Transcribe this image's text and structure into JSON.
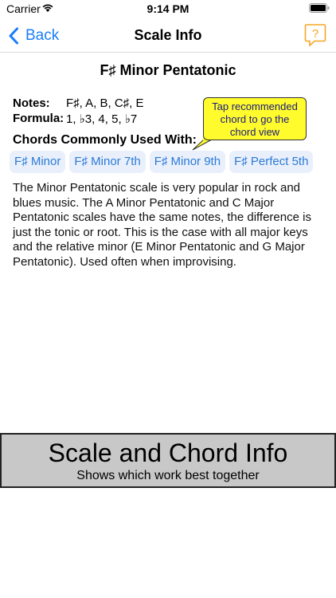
{
  "status_bar": {
    "carrier": "Carrier",
    "time": "9:14 PM"
  },
  "nav": {
    "back_label": "Back",
    "title": "Scale Info",
    "help_icon": "help-question-bubble-icon",
    "accent_color": "#1a7ef7",
    "help_color": "#f5a623"
  },
  "scale": {
    "title": "F♯ Minor Pentatonic",
    "notes_label": "Notes:",
    "notes_value": "F♯, A, B, C♯, E",
    "formula_label": "Formula:",
    "formula_value": "1, ♭3, 4, 5, ♭7"
  },
  "tooltip": {
    "text_line1": "Tap recommended",
    "text_line2": "chord to go the",
    "text_line3": "chord view",
    "background": "#fffb2c"
  },
  "chords": {
    "heading": "Chords Commonly Used With:",
    "items": [
      {
        "label": "F♯ Minor"
      },
      {
        "label": "F♯ Minor 7th"
      },
      {
        "label": "F♯ Minor 9th"
      },
      {
        "label": "F♯ Perfect 5th"
      }
    ]
  },
  "description": "The Minor Pentatonic scale is very popular in rock and blues music. The A Minor Pentatonic and C Major Pentatonic scales have the same notes, the difference is just the tonic or root. This is the case with all major keys and the relative minor (E Minor Pentatonic and G Major Pentatonic). Used often when improvising.",
  "banner": {
    "title": "Scale and Chord Info",
    "subtitle": "Shows which work best together"
  }
}
